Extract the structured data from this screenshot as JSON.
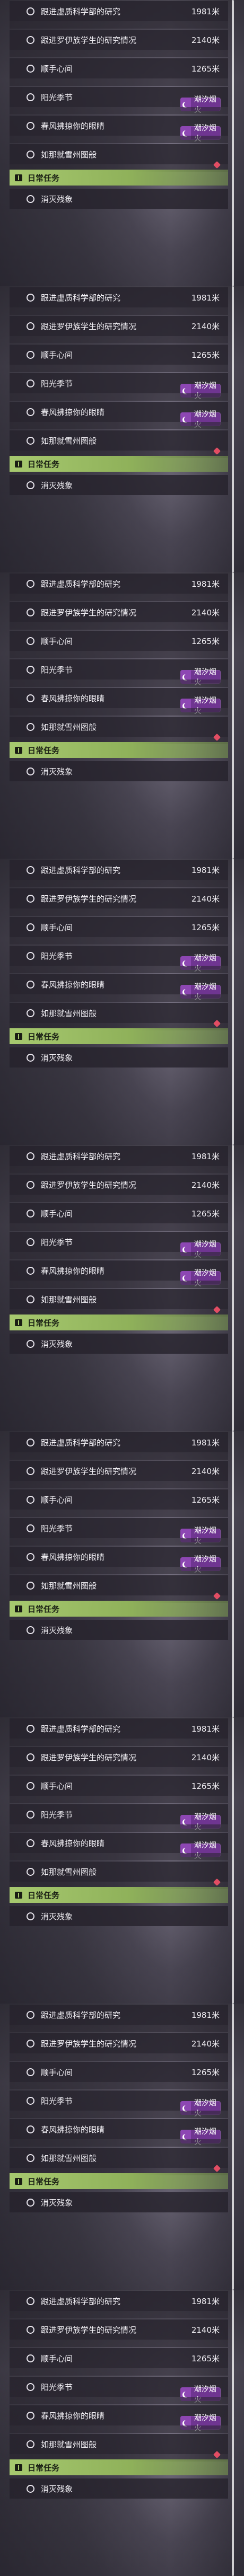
{
  "quest_tracker": {
    "main_quests": [
      {
        "name": "跟进虚质科学部的研究",
        "distance": "1981米"
      },
      {
        "name": "跟进罗伊族学生的研究情况",
        "distance": "2140米"
      },
      {
        "name": "顺手心间",
        "distance": "1265米"
      }
    ],
    "event_quests": [
      {
        "name": "阳光季节",
        "badge": "潮汐烟火"
      },
      {
        "name": "春风拂掠你的眼睛",
        "badge": "潮汐烟火"
      },
      {
        "name": "如那就雪州图般",
        "badge": ""
      }
    ],
    "daily_header": "日常任务",
    "daily_quests": [
      {
        "name": "消灭残象"
      }
    ]
  },
  "colors": {
    "daily_header_bg": "#a7c96f",
    "event_badge": "#6f3591",
    "alert_diamond": "#e24d63"
  },
  "icons": {
    "bullet": "circle-outline-icon",
    "event": "crescent-moon-icon",
    "daily": "book-icon",
    "alert": "red-diamond-icon"
  }
}
